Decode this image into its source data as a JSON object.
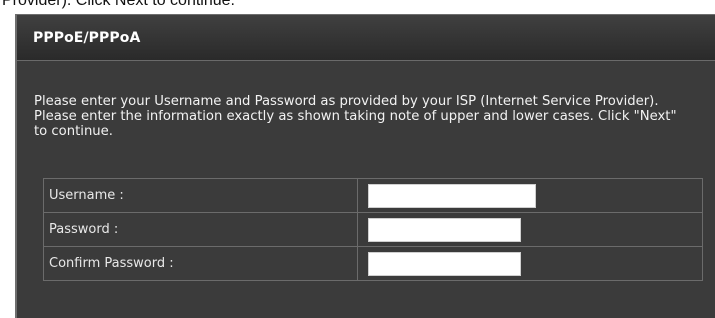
{
  "caption": "Provider). Click Next to continue.",
  "panel": {
    "title": "PPPoE/PPPoA",
    "instructions": "Please enter your Username and Password as provided by your ISP (Internet Service Provider). Please enter the information exactly as shown taking note of upper and lower cases. Click \"Next\" to continue."
  },
  "form": {
    "fields": [
      {
        "label": "Username :",
        "value": "",
        "type": "text"
      },
      {
        "label": "Password :",
        "value": "",
        "type": "password"
      },
      {
        "label": "Confirm Password :",
        "value": "",
        "type": "password"
      }
    ]
  }
}
